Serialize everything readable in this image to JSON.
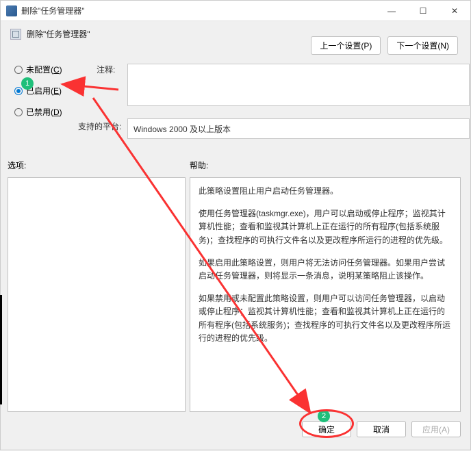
{
  "titlebar": {
    "title": "删除\"任务管理器\""
  },
  "subheader": {
    "title": "删除\"任务管理器\""
  },
  "nav": {
    "prev": "上一个设置(P)",
    "next": "下一个设置(N)"
  },
  "radios": {
    "unconfigured": {
      "label": "未配置(",
      "accel": "C",
      "suffix": ")"
    },
    "enabled": {
      "label": "已启用(",
      "accel": "E",
      "suffix": ")"
    },
    "disabled": {
      "label": "已禁用(",
      "accel": "D",
      "suffix": ")"
    }
  },
  "labels": {
    "comment": "注释:",
    "platform": "支持的平台:",
    "options": "选项:",
    "help": "帮助:"
  },
  "platform_text": "Windows 2000 及以上版本",
  "help": {
    "p1": "此策略设置阻止用户启动任务管理器。",
    "p2": "使用任务管理器(taskmgr.exe)，用户可以启动或停止程序；监视其计算机性能；查看和监视其计算机上正在运行的所有程序(包括系统服务)；查找程序的可执行文件名以及更改程序所运行的进程的优先级。",
    "p3": "如果启用此策略设置，则用户将无法访问任务管理器。如果用户尝试启动任务管理器，则将显示一条消息，说明某策略阻止该操作。",
    "p4": "如果禁用或未配置此策略设置，则用户可以访问任务管理器，以启动或停止程序；监视其计算机性能；查看和监视其计算机上正在运行的所有程序(包括系统服务)；查找程序的可执行文件名以及更改程序所运行的进程的优先级。"
  },
  "buttons": {
    "ok": "确定",
    "cancel": "取消",
    "apply": "应用(A)"
  },
  "annotations": {
    "badge1": "1",
    "badge2": "2"
  }
}
